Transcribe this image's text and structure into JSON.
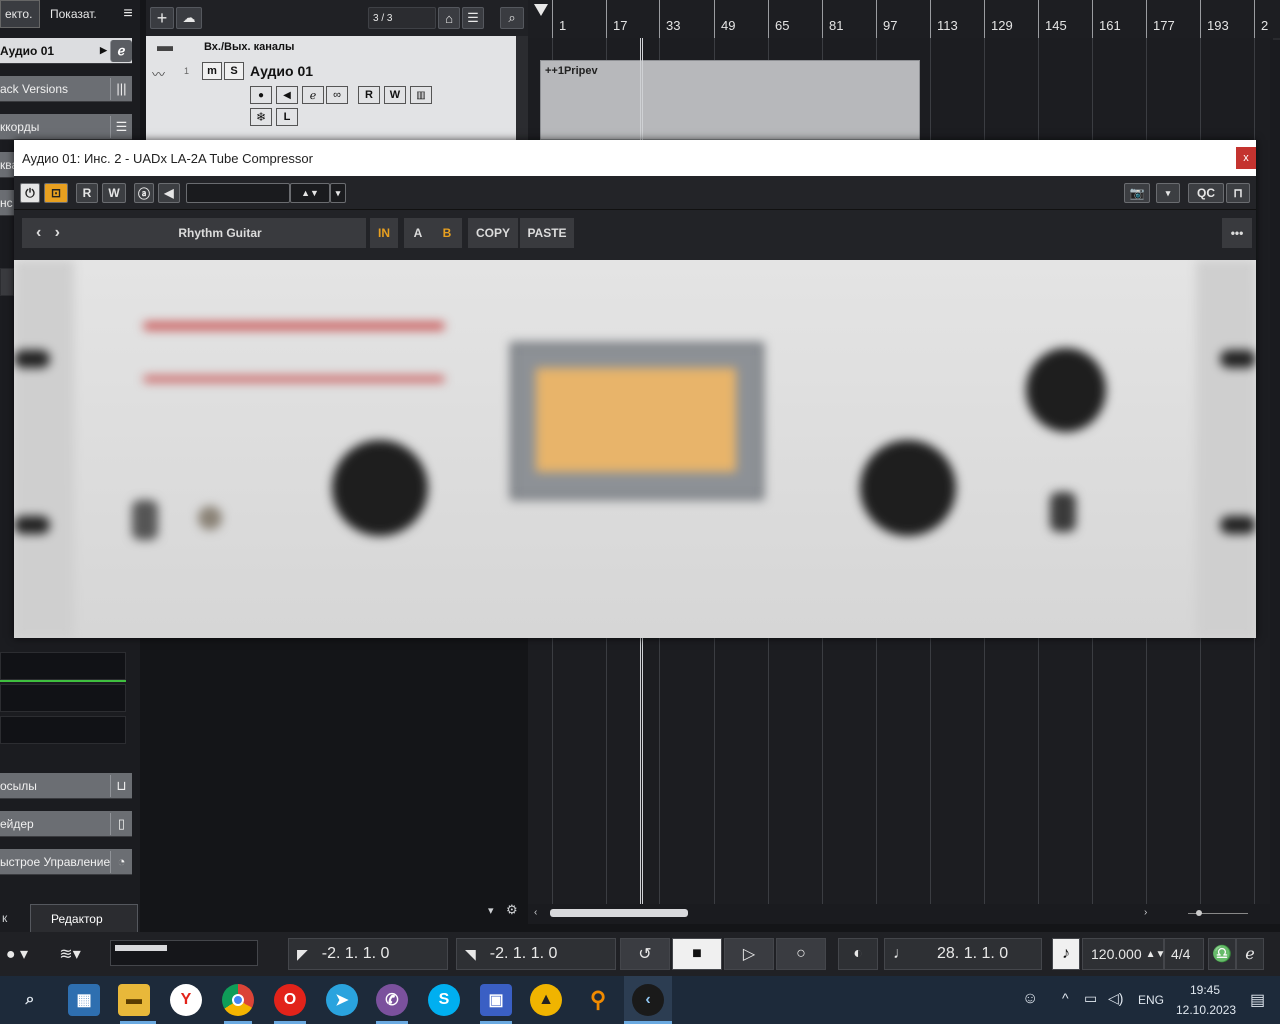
{
  "left_panel": {
    "tab_project": "екто.",
    "tab_show": "Показат.",
    "track_name": "Аудио 01",
    "inspector_sections": [
      "ack Versions",
      "ккорды",
      "ква",
      "нс"
    ],
    "sends": "осылы",
    "fader": "ейдер",
    "quick_controls": "ыстрое Управление"
  },
  "bottom_tabs": {
    "left": "к",
    "editor": "Редактор"
  },
  "toolbar": {
    "track_counter": "3 / 3"
  },
  "tracks": [
    {
      "name": "Вх./Вых. каналы"
    },
    {
      "number": "1",
      "name": "Аудио 01",
      "mute": "m",
      "solo": "S",
      "read": "R",
      "write": "W",
      "lock": "L"
    }
  ],
  "ruler": {
    "bars": [
      "1",
      "17",
      "33",
      "49",
      "65",
      "81",
      "97",
      "113",
      "129",
      "145",
      "161",
      "177",
      "193",
      "2"
    ]
  },
  "event": {
    "name": "++1Pripev"
  },
  "plugin": {
    "title": "Аудио 01: Инс. 2 - UADx LA-2A Tube Compressor",
    "close": "x",
    "read": "R",
    "write": "W",
    "qc": "QC",
    "preset": "Rhythm Guitar",
    "in": "IN",
    "a": "A",
    "b": "B",
    "copy": "COPY",
    "paste": "PASTE",
    "more": "•••",
    "accent": "#e8a020"
  },
  "transport": {
    "left_locator": "-2.  1.  1.    0",
    "right_locator": "-2.  1.  1.    0",
    "position": "28.  1.  1.    0",
    "tempo": "120.000",
    "signature": "4/4"
  },
  "taskbar": {
    "lang": "ENG",
    "time": "19:45",
    "date": "12.10.2023"
  }
}
